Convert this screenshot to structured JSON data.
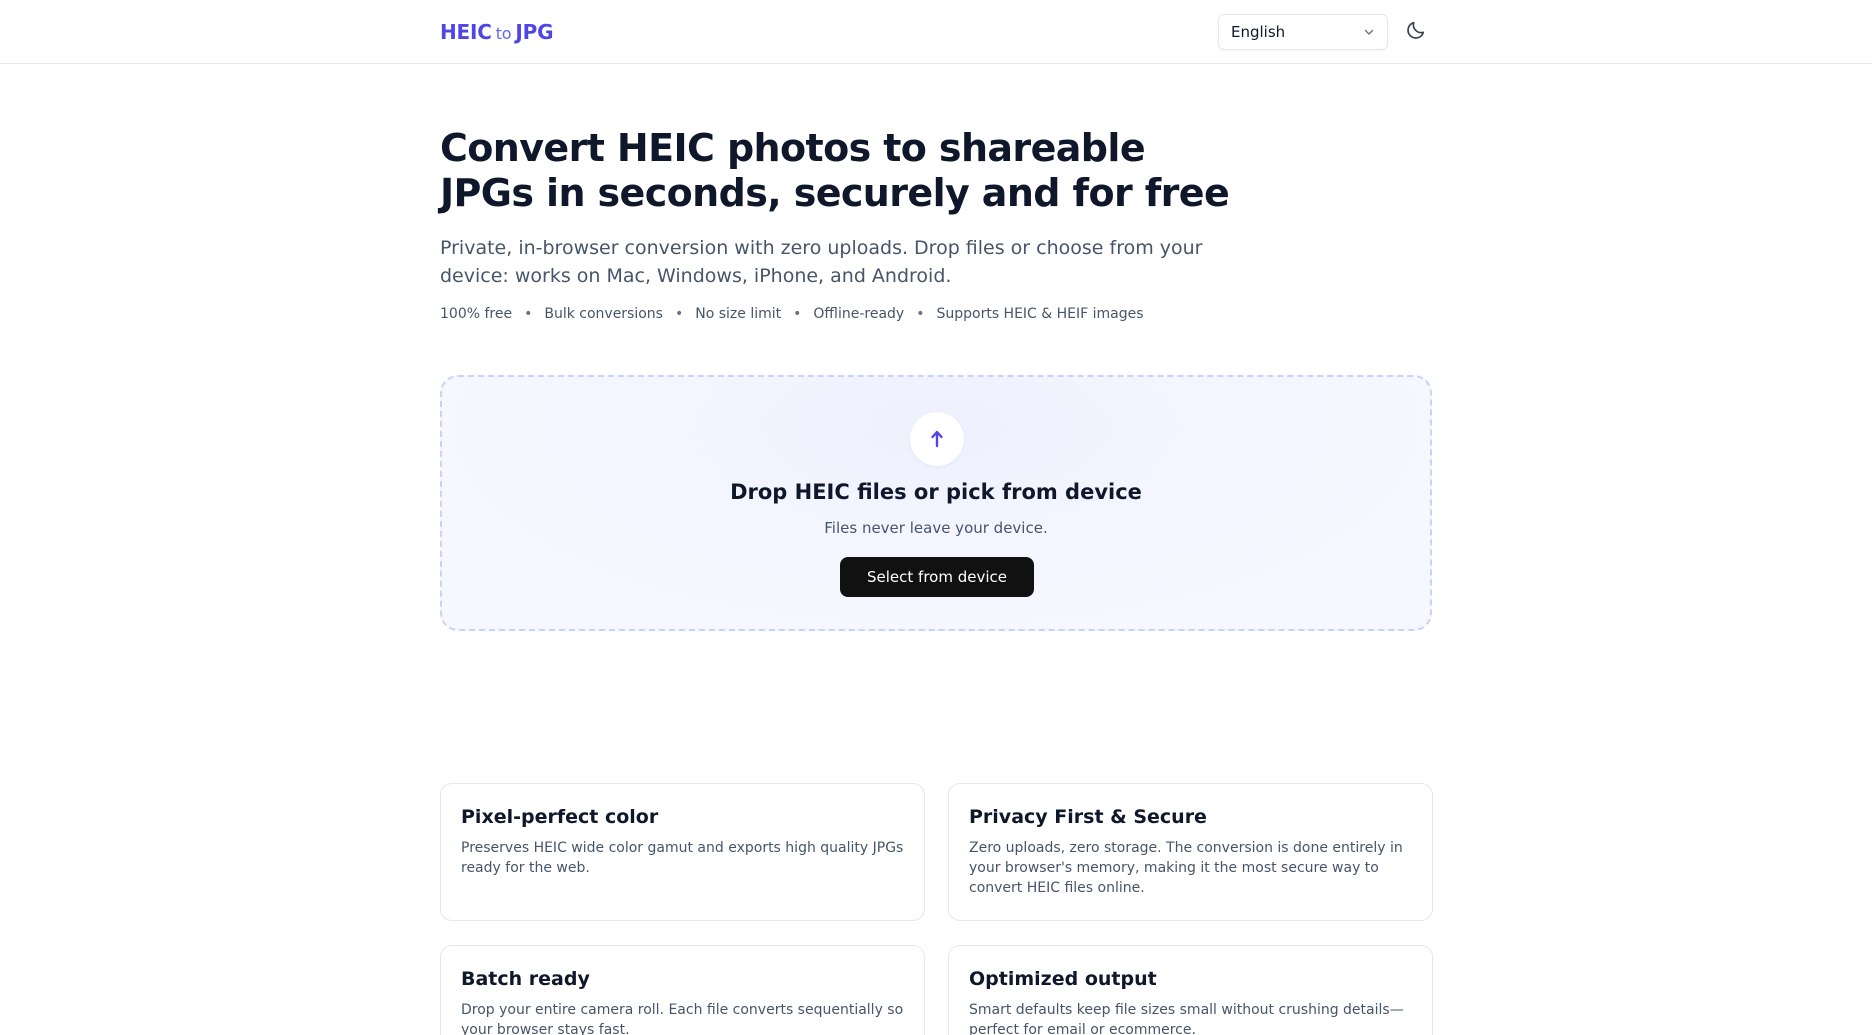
{
  "header": {
    "logo_heic": "HEIC",
    "logo_to": "to",
    "logo_jpg": "JPG",
    "language_selected": "English",
    "language_icon": "chevron-down-icon",
    "theme_icon": "moon-icon"
  },
  "hero": {
    "title": "Convert HEIC photos to shareable JPGs in seconds, securely and for free",
    "subtitle": "Private, in-browser conversion with zero uploads. Drop files or choose from your device: works on Mac, Windows, iPhone, and Android.",
    "features": [
      "100% free",
      "Bulk conversions",
      "No size limit",
      "Offline-ready",
      "Supports HEIC & HEIF images"
    ]
  },
  "dropzone": {
    "icon": "upload-arrow-icon",
    "title": "Drop HEIC files or pick from device",
    "note": "Files never leave your device.",
    "button_label": "Select from device"
  },
  "cards": [
    {
      "title": "Pixel-perfect color",
      "body": "Preserves HEIC wide color gamut and exports high quality JPGs ready for the web."
    },
    {
      "title": "Privacy First & Secure",
      "body": "Zero uploads, zero storage. The conversion is done entirely in your browser's memory, making it the most secure way to convert HEIC files online."
    },
    {
      "title": "Batch ready",
      "body": "Drop your entire camera roll. Each file converts sequentially so your browser stays fast."
    },
    {
      "title": "Optimized output",
      "body": "Smart defaults keep file sizes small without crushing details—perfect for email or ecommerce."
    }
  ],
  "colors": {
    "brand": "#4f46e5",
    "button": "#111111",
    "dropzone_border": "#c7d2fe",
    "dropzone_bg": "#f4f6ff"
  }
}
